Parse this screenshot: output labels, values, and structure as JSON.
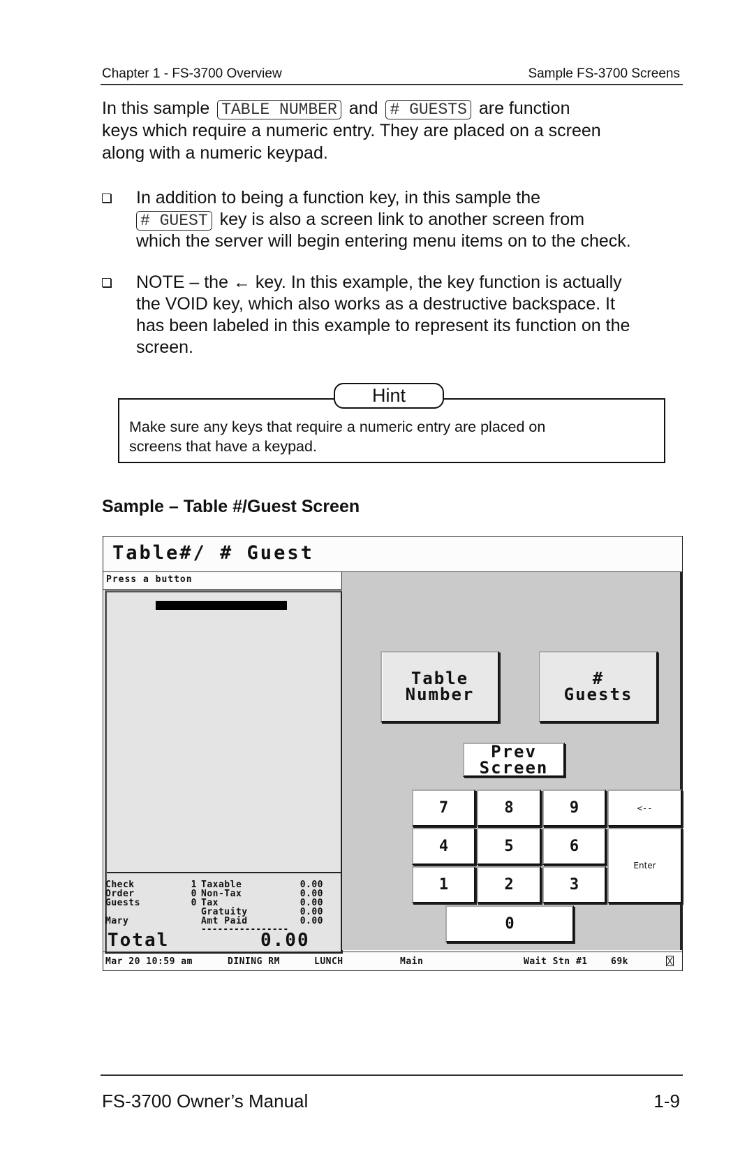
{
  "header": {
    "left": "Chapter 1 - FS-3700 Overview",
    "right": "Sample FS-3700 Screens"
  },
  "intro": {
    "part1": "In this sample",
    "key1": "TABLE NUMBER",
    "part2": "and",
    "key2": "# GUESTS",
    "part3": "are function",
    "line2": "keys which require a numeric entry.  They are placed on a screen",
    "line3": "along with a numeric keypad."
  },
  "bullets": [
    {
      "line1": "In addition to being a function key, in this sample the",
      "key": "# GUEST",
      "line2_rest": "key is also a screen link to another screen from",
      "line3": "which the server will begin entering menu items on to the check."
    },
    {
      "line1": "NOTE – the ← key.  In this example, the key function is actually",
      "line2": "the VOID key, which also works as a destructive backspace.  It",
      "line3": "has been labeled in this example to represent its function on the",
      "line4": "screen."
    }
  ],
  "hint": {
    "title": "Hint",
    "text_line1": "Make sure any keys that require a numeric entry are placed on",
    "text_line2": "screens that have a keypad."
  },
  "section_title": "Sample – Table #/Guest Screen",
  "pos_screen": {
    "title": "Table#/ # Guest",
    "prompt": "Press a button",
    "summary_left": [
      {
        "label": "Check",
        "value": "1"
      },
      {
        "label": "Order",
        "value": "0"
      },
      {
        "label": "Guests",
        "value": "0"
      },
      {
        "label": "",
        "value": ""
      },
      {
        "label": "Mary",
        "value": ""
      }
    ],
    "summary_right": [
      {
        "label": "Taxable",
        "value": "0.00"
      },
      {
        "label": "Non-Tax",
        "value": "0.00"
      },
      {
        "label": "Tax",
        "value": "0.00"
      },
      {
        "label": "Gratuity",
        "value": "0.00"
      },
      {
        "label": "Amt Paid",
        "value": "0.00"
      }
    ],
    "separator": "----------------",
    "total_label": "Total",
    "total_value": "0.00",
    "buttons": {
      "table_number": "Table\nNumber",
      "guests": "#\nGuests",
      "prev_screen": "Prev\nScreen"
    },
    "keypad": {
      "k7": "7",
      "k8": "8",
      "k9": "9",
      "back": "<--",
      "k4": "4",
      "k5": "5",
      "k6": "6",
      "enter": "Enter",
      "k1": "1",
      "k2": "2",
      "k3": "3",
      "k0": "0"
    },
    "status": {
      "datetime": "Mar 20 10:59 am",
      "area": "DINING RM",
      "period": "LUNCH",
      "screen": "Main",
      "station": "Wait Stn #1",
      "memory": "69k",
      "indicator_icon": "hourglass-box-icon"
    }
  },
  "footer": {
    "left": "FS-3700 Owner’s Manual",
    "right": "1-9"
  }
}
